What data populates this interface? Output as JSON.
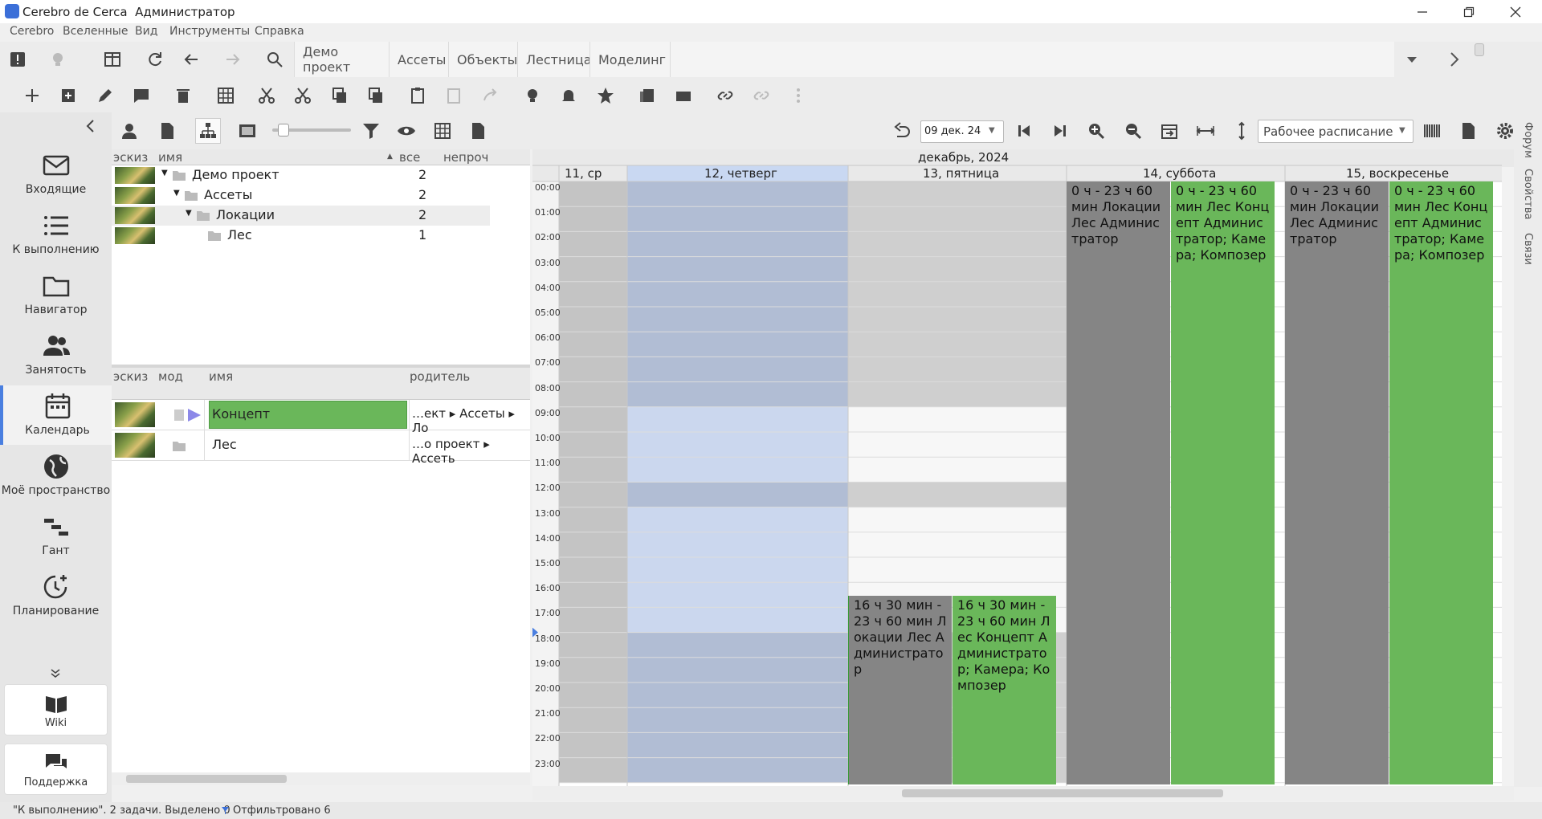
{
  "titlebar": {
    "app": "Cerebro de Cerca",
    "user": "Администратор"
  },
  "menu": [
    "Cerebro",
    "Вселенные",
    "Вид",
    "Инструменты",
    "Справка"
  ],
  "tabs": [
    "Демо проект",
    "Ассеты",
    "Объекты",
    "Лестница",
    "Моделинг"
  ],
  "sidebar": {
    "items": [
      {
        "label": "Входящие",
        "icon": "mail-icon"
      },
      {
        "label": "К выполнению",
        "icon": "list-icon"
      },
      {
        "label": "Навигатор",
        "icon": "folder-icon"
      },
      {
        "label": "Занятость",
        "icon": "people-icon"
      },
      {
        "label": "Календарь",
        "icon": "calendar-icon"
      },
      {
        "label": "Моё пространство",
        "icon": "globe-icon"
      },
      {
        "label": "Гант",
        "icon": "gantt-icon"
      },
      {
        "label": "Планирование",
        "icon": "clock-plus-icon"
      }
    ],
    "active": "Календарь",
    "wiki": "Wiki",
    "support": "Поддержка"
  },
  "tree": {
    "headers": {
      "thumb": "эскиз",
      "name": "имя",
      "all": "все",
      "unread": "непроч"
    },
    "rows": [
      {
        "name": "Демо проект",
        "count": "2"
      },
      {
        "name": "Ассеты",
        "count": "2"
      },
      {
        "name": "Локации",
        "count": "2"
      },
      {
        "name": "Лес",
        "count": "1"
      }
    ]
  },
  "list": {
    "headers": {
      "thumb": "эскиз",
      "mod": "мод",
      "name": "имя",
      "parent": "родитель"
    },
    "rows": [
      {
        "name": "Концепт",
        "parent": "…ект ▸ Ассеты ▸ Ло"
      },
      {
        "name": "Лес",
        "parent": "…о проект ▸ Ассеть"
      }
    ]
  },
  "calendar": {
    "date": "09 дек. 24",
    "schedule": "Рабочее расписание",
    "month": "декабрь, 2024",
    "days": [
      "11, ср",
      "12, четверг",
      "13, пятница",
      "14, суббота",
      "15, воскресенье"
    ],
    "hours": [
      "00:00",
      "01:00",
      "02:00",
      "03:00",
      "04:00",
      "05:00",
      "06:00",
      "07:00",
      "08:00",
      "09:00",
      "10:00",
      "11:00",
      "12:00",
      "13:00",
      "14:00",
      "15:00",
      "16:00",
      "17:00",
      "18:00",
      "19:00",
      "20:00",
      "21:00",
      "22:00",
      "23:00"
    ],
    "events": {
      "sat_a": "0 ч - 23 ч 60 мин Локации Лес Администратор",
      "sat_b": "0 ч - 23 ч 60 мин Лес Концепт Администратор; Камера; Композер",
      "sun_a": "0 ч - 23 ч 60 мин Локации Лес Администратор",
      "sun_b": "0 ч - 23 ч 60 мин Лес Концепт Администратор; Камера; Композер",
      "fri_a": "16 ч 30 мин - 23 ч 60 мин Локации Лес Администратор",
      "fri_b": "16 ч 30 мин - 23 ч 60 мин Лес Концепт Администратор; Камера; Композер"
    }
  },
  "right_tabs": [
    "Форум",
    "Свойства",
    "Связи"
  ],
  "status": {
    "text": "\"К выполнению\". 2 задачи. Выделено 0",
    "filter": "Отфильтровано 6"
  },
  "colors": {
    "accent": "#4a7fe0",
    "green": "#6ab75a",
    "gray_event": "#858585",
    "highlight": "#c9d8f2"
  }
}
